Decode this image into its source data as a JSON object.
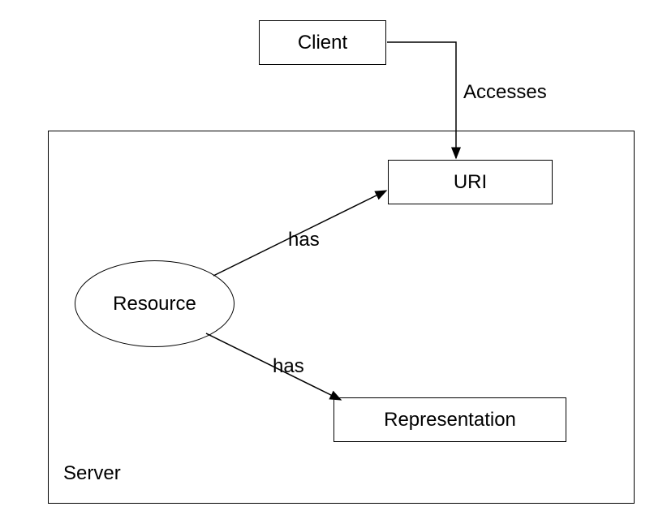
{
  "nodes": {
    "client": "Client",
    "server": "Server",
    "uri": "URI",
    "representation": "Representation",
    "resource": "Resource"
  },
  "edges": {
    "accesses": "Accesses",
    "has1": "has",
    "has2": "has"
  }
}
